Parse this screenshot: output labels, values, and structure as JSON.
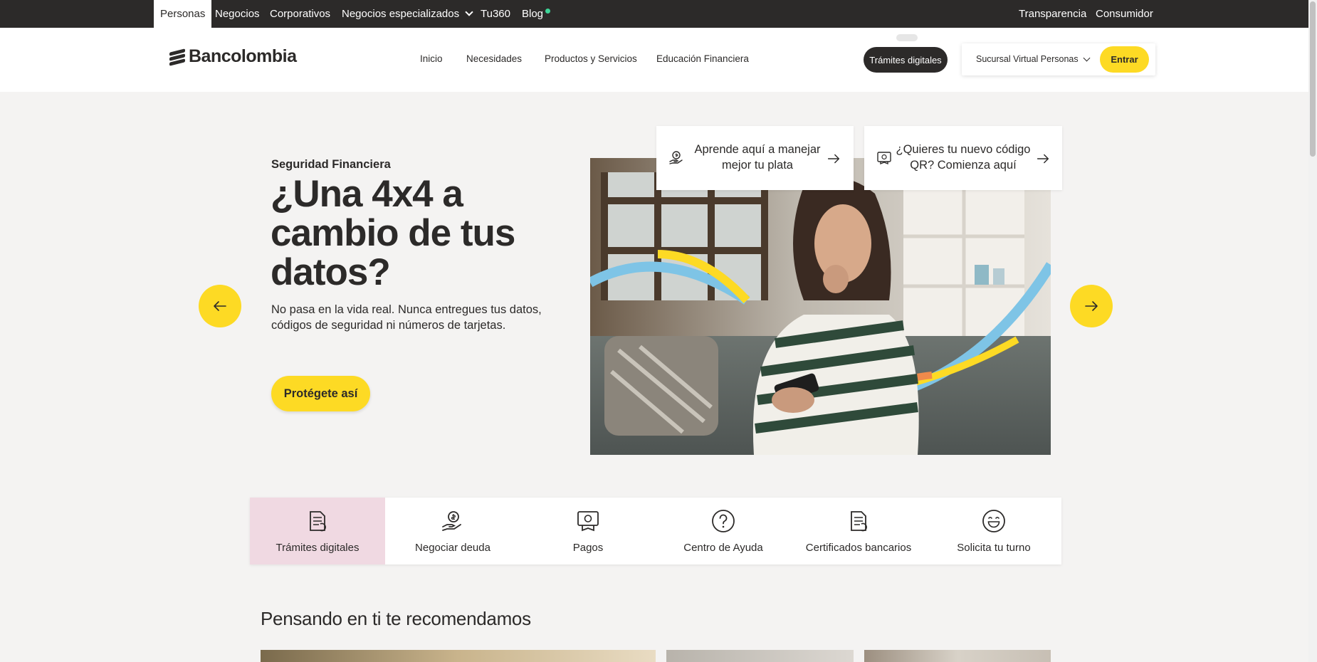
{
  "topbar": {
    "left_items": [
      "Personas",
      "Negocios",
      "Corporativos",
      "Negocios especializados",
      "Tu360",
      "Blog"
    ],
    "right_items": [
      "Transparencia",
      "Consumidor"
    ]
  },
  "header": {
    "brand": "Bancolombia",
    "nav": [
      "Inicio",
      "Necesidades",
      "Productos y Servicios",
      "Educación Financiera"
    ],
    "tramites_label": "Trámites digitales",
    "sucursal_label": "Sucursal Virtual Personas",
    "entrar_label": "Entrar"
  },
  "hero": {
    "eyebrow": "Seguridad Financiera",
    "title": "¿Una 4x4 a cambio de tus datos?",
    "description": "No pasa en la vida real. Nunca entregues tus datos, códigos de seguridad ni números de tarjetas.",
    "cta": "Protégete así"
  },
  "quick_cards": [
    {
      "text": "Aprende aquí a manejar mejor tu plata",
      "icon": "money-hand-icon"
    },
    {
      "text": "¿Quieres tu nuevo código QR? Comienza aquí",
      "icon": "qr-bill-icon"
    }
  ],
  "quick_access": [
    {
      "label": "Trámites digitales",
      "icon": "document-icon",
      "active": true
    },
    {
      "label": "Negociar deuda",
      "icon": "money-hand-icon",
      "active": false
    },
    {
      "label": "Pagos",
      "icon": "bill-icon",
      "active": false
    },
    {
      "label": "Centro de Ayuda",
      "icon": "help-icon",
      "active": false
    },
    {
      "label": "Certificados bancarios",
      "icon": "document-icon",
      "active": false
    },
    {
      "label": "Solicita tu turno",
      "icon": "smile-icon",
      "active": false
    }
  ],
  "recommend": {
    "title": "Pensando en ti te recomendamos"
  },
  "colors": {
    "yellow": "#fdda24",
    "dark": "#2c2a29",
    "pink_active": "#f0d9e2",
    "background": "#f4f3f2"
  }
}
